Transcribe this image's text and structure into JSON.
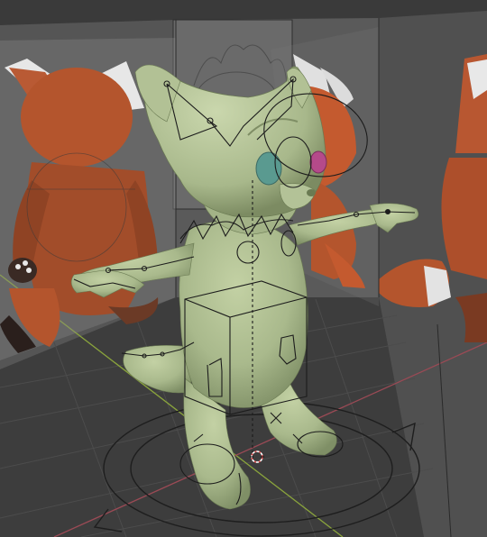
{
  "viewport": {
    "view": "3d-viewport-solid-shading",
    "background_color": "#404040",
    "floor_grid": true,
    "axis_lines": {
      "x_axis_color": "#9a4a55",
      "y_axis_color": "#8aa43c"
    },
    "overlays": [
      "armature-bones",
      "rig-controls",
      "reference-image-planes",
      "3d-cursor"
    ]
  },
  "scene": {
    "character": {
      "name_visible": "",
      "pose": "t-pose",
      "body_color": "#a9b98c",
      "eye_left_color": "#5a9a90",
      "eye_right_color": "#b54a8a"
    },
    "reference_images": [
      {
        "id": "ref-left",
        "view": "back",
        "subject": "red-panda",
        "fur_color": "#b5532c"
      },
      {
        "id": "ref-center",
        "view": "front",
        "subject": "red-panda-sketch",
        "fur_color": "#9a9a9a"
      },
      {
        "id": "ref-right",
        "view": "side",
        "subject": "red-panda",
        "fur_color": "#c25a2f"
      }
    ],
    "cursor_3d": {
      "present": true,
      "ring_colors": [
        "#e05050",
        "#ffffff"
      ]
    }
  }
}
